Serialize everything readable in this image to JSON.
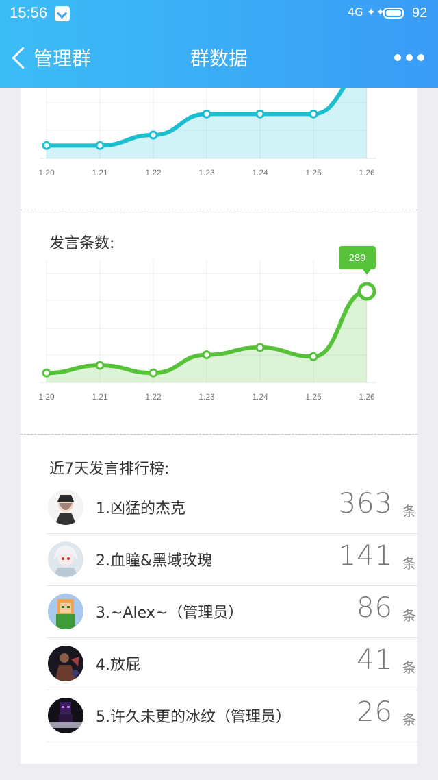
{
  "status_bar": {
    "time": "15:56",
    "signal": "4G ✦✦",
    "battery_level": "92"
  },
  "nav": {
    "back_label": "管理群",
    "title": "群数据"
  },
  "chart_data": [
    {
      "type": "area",
      "title": "",
      "x": [
        "1.20",
        "1.21",
        "1.22",
        "1.23",
        "1.24",
        "1.25",
        "1.26"
      ],
      "series": [
        {
          "values": [
            2,
            2,
            3,
            5,
            5,
            5,
            9
          ]
        }
      ],
      "color": "#1bbfd0",
      "grid": true
    },
    {
      "type": "area",
      "title": "发言条数:",
      "x": [
        "1.20",
        "1.21",
        "1.22",
        "1.23",
        "1.24",
        "1.25",
        "1.26"
      ],
      "series": [
        {
          "values": [
            20,
            45,
            20,
            80,
            104,
            74,
            289
          ]
        }
      ],
      "highlight_label": "289",
      "color": "#55c23a",
      "grid": true
    }
  ],
  "ranking": {
    "title": "近7天发言排行榜:",
    "unit": "条",
    "rows": [
      {
        "name": "1.凶猛的杰克",
        "count": "363"
      },
      {
        "name": "2.血瞳&黑域玫瑰",
        "count": "141"
      },
      {
        "name": "3.~Alex~（管理员）",
        "count": "86"
      },
      {
        "name": "4.放屁",
        "count": "41"
      },
      {
        "name": "5.许久未更的冰纹（管理员）",
        "count": "26"
      }
    ]
  }
}
